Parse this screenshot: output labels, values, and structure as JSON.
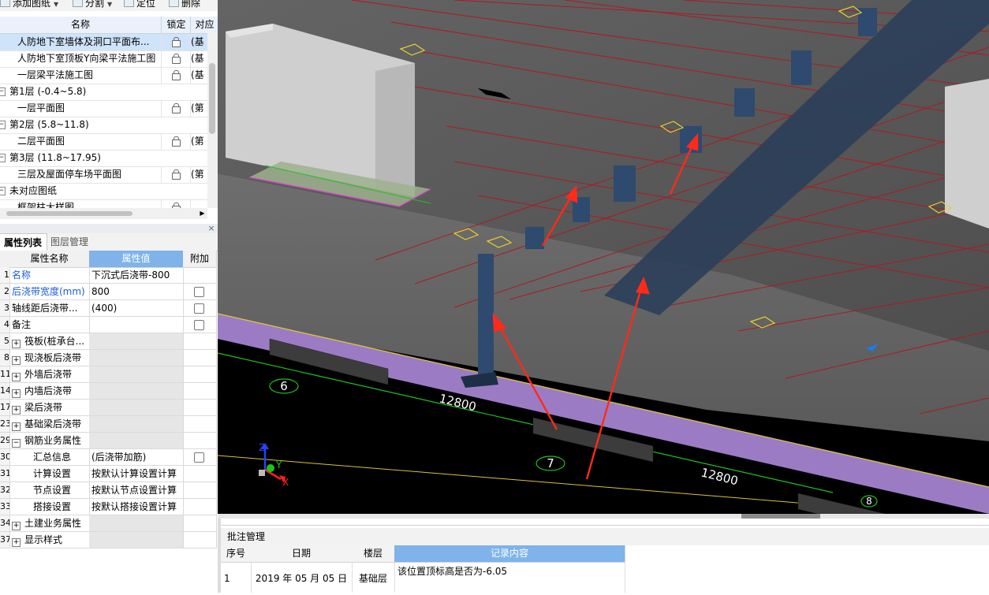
{
  "toolbar": {
    "add_drawing": "添加图纸",
    "split": "分割",
    "locate": "定位",
    "delete": "删除"
  },
  "drawings": {
    "columns": {
      "name": "名称",
      "lock": "锁定",
      "map": "对应"
    },
    "rows": [
      {
        "name": "人防地下室墙体及洞口平面布...",
        "type": "file",
        "lock": true,
        "map": "(基",
        "selected": true
      },
      {
        "name": "人防地下室顶板Y向梁平法施工图",
        "type": "file",
        "lock": true,
        "map": "(基"
      },
      {
        "name": "一层梁平法施工图",
        "type": "file",
        "lock": true,
        "map": "(基"
      },
      {
        "name": "第1层 (-0.4~5.8)",
        "type": "group"
      },
      {
        "name": "一层平面图",
        "type": "file",
        "lock": true,
        "map": "(第"
      },
      {
        "name": "第2层 (5.8~11.8)",
        "type": "group"
      },
      {
        "name": "二层平面图",
        "type": "file",
        "lock": true,
        "map": "(第"
      },
      {
        "name": "第3层 (11.8~17.95)",
        "type": "group"
      },
      {
        "name": "三层及屋面停车场平面图",
        "type": "file",
        "lock": true,
        "map": "(第"
      },
      {
        "name": "未对应图纸",
        "type": "group"
      },
      {
        "name": "框架柱大样图",
        "type": "file",
        "lock": true,
        "map": ""
      }
    ]
  },
  "properties": {
    "tabs": [
      "属性列表",
      "图层管理"
    ],
    "columns": {
      "name": "属性名称",
      "value": "属性值",
      "extra": "附加"
    },
    "rows": [
      {
        "num": "1",
        "name": "名称",
        "value": "下沉式后浇带-800",
        "blue": true,
        "check": false
      },
      {
        "num": "2",
        "name": "后浇带宽度(mm)",
        "value": "800",
        "blue": true,
        "check": true
      },
      {
        "num": "3",
        "name": "轴线距后浇带...",
        "value": "(400)",
        "check": true
      },
      {
        "num": "4",
        "name": "备注",
        "value": "",
        "check": true
      },
      {
        "num": "5",
        "name": "筏板(桩承台...",
        "value": "",
        "expand": "+",
        "grey": true
      },
      {
        "num": "8",
        "name": "现浇板后浇带",
        "value": "",
        "expand": "+",
        "grey": true
      },
      {
        "num": "11",
        "name": "外墙后浇带",
        "value": "",
        "expand": "+",
        "grey": true
      },
      {
        "num": "14",
        "name": "内墙后浇带",
        "value": "",
        "expand": "+",
        "grey": true
      },
      {
        "num": "17",
        "name": "梁后浇带",
        "value": "",
        "expand": "+",
        "grey": true
      },
      {
        "num": "23",
        "name": "基础梁后浇带",
        "value": "",
        "expand": "+",
        "grey": true
      },
      {
        "num": "29",
        "name": "钢筋业务属性",
        "value": "",
        "expand": "-",
        "grey": true
      },
      {
        "num": "30",
        "name": "汇总信息",
        "value": "(后浇带加筋)",
        "indent": true,
        "check": true
      },
      {
        "num": "31",
        "name": "计算设置",
        "value": "按默认计算设置计算",
        "indent": true
      },
      {
        "num": "32",
        "name": "节点设置",
        "value": "按默认节点设置计算",
        "indent": true
      },
      {
        "num": "33",
        "name": "搭接设置",
        "value": "按默认搭接设置计算",
        "indent": true
      },
      {
        "num": "34",
        "name": "土建业务属性",
        "value": "",
        "expand": "+",
        "grey": true
      },
      {
        "num": "37",
        "name": "显示样式",
        "value": "",
        "expand": "+",
        "grey": true
      }
    ]
  },
  "viewport": {
    "axis_labels": [
      "6",
      "7",
      "8"
    ],
    "dimension_labels": [
      "12800",
      "12800"
    ],
    "axis_gizmo": {
      "z": "Z",
      "y": "Y",
      "x": "X"
    },
    "colors": {
      "background": "#000000",
      "slab": "#5a5a5a",
      "strip": "#9b7cc4",
      "grid": "#b01820",
      "column": "#2e4a6e",
      "arrow": "#ff2a1a"
    }
  },
  "comments": {
    "title": "批注管理",
    "columns": [
      "序号",
      "日期",
      "楼层",
      "记录内容"
    ],
    "rows": [
      {
        "no": "1",
        "date": "2019 年 05 月 05 日",
        "floor": "基础层",
        "content": "该位置顶标高是否为-6.05"
      }
    ]
  }
}
